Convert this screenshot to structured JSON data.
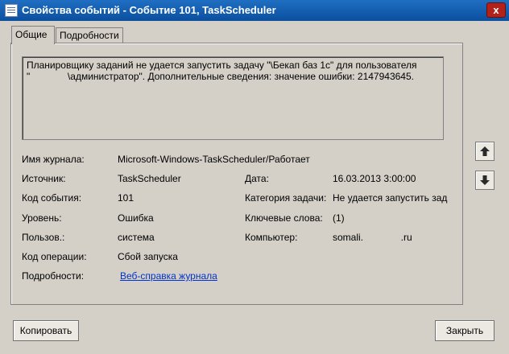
{
  "window": {
    "title": "Свойства событий - Событие 101, TaskScheduler",
    "icon": "event-log-icon",
    "close_glyph": "x"
  },
  "tabs": [
    {
      "label": "Общие",
      "active": true
    },
    {
      "label": "Подробности",
      "active": false
    }
  ],
  "description": {
    "line1": "Планировщику заданий не удается запустить задачу \"\\Бекап баз 1с\" для пользователя",
    "line2": "\"              \\администратор\". Дополнительные сведения: значение ошибки: 2147943645."
  },
  "fields": {
    "log_name": {
      "label": "Имя журнала:",
      "value": "Microsoft-Windows-TaskScheduler/Работает"
    },
    "source": {
      "label": "Источник:",
      "value": "TaskScheduler"
    },
    "date": {
      "label": "Дата:",
      "value": "16.03.2013 3:00:00"
    },
    "event_id": {
      "label": "Код события:",
      "value": "101"
    },
    "task_category": {
      "label": "Категория задачи:",
      "value": "Не удается запустить задач"
    },
    "level": {
      "label": "Уровень:",
      "value": "Ошибка"
    },
    "keywords": {
      "label": "Ключевые слова:",
      "value": "(1)"
    },
    "user": {
      "label": "Пользов.:",
      "value": "система"
    },
    "computer": {
      "label": "Компьютер:",
      "value": "somali.              .ru"
    },
    "opcode": {
      "label": "Код операции:",
      "value": "Сбой запуска"
    },
    "more_info": {
      "label": "Подробности:",
      "value": "Веб-справка журнала"
    }
  },
  "nav": {
    "up_icon": "arrow-up-icon",
    "down_icon": "arrow-down-icon"
  },
  "buttons": {
    "copy": "Копировать",
    "close": "Закрыть"
  }
}
